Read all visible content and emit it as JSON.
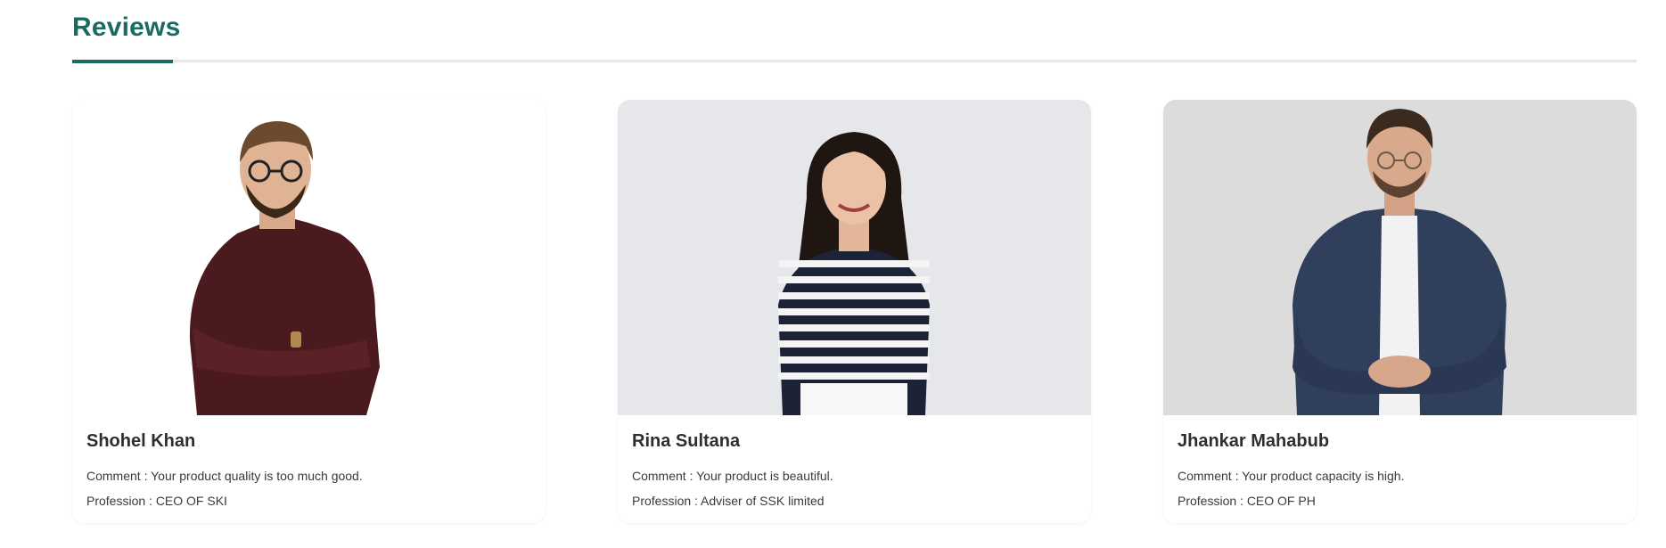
{
  "section": {
    "title": "Reviews"
  },
  "reviews": [
    {
      "name": "Shohel Khan",
      "comment": "Comment : Your product quality is too much good.",
      "profession": "Profession : CEO OF SKI",
      "photo_bg": "#ffffff"
    },
    {
      "name": "Rina Sultana",
      "comment": "Comment : Your product is beautiful.",
      "profession": "Profession : Adviser of SSK limited",
      "photo_bg": "#e5e7ea"
    },
    {
      "name": "Jhankar Mahabub",
      "comment": "Comment : Your product capacity is high.",
      "profession": "Profession : CEO OF PH",
      "photo_bg": "#dcdcdc"
    }
  ],
  "colors": {
    "accent": "#1a6b62",
    "rule": "#e6e8ea"
  }
}
